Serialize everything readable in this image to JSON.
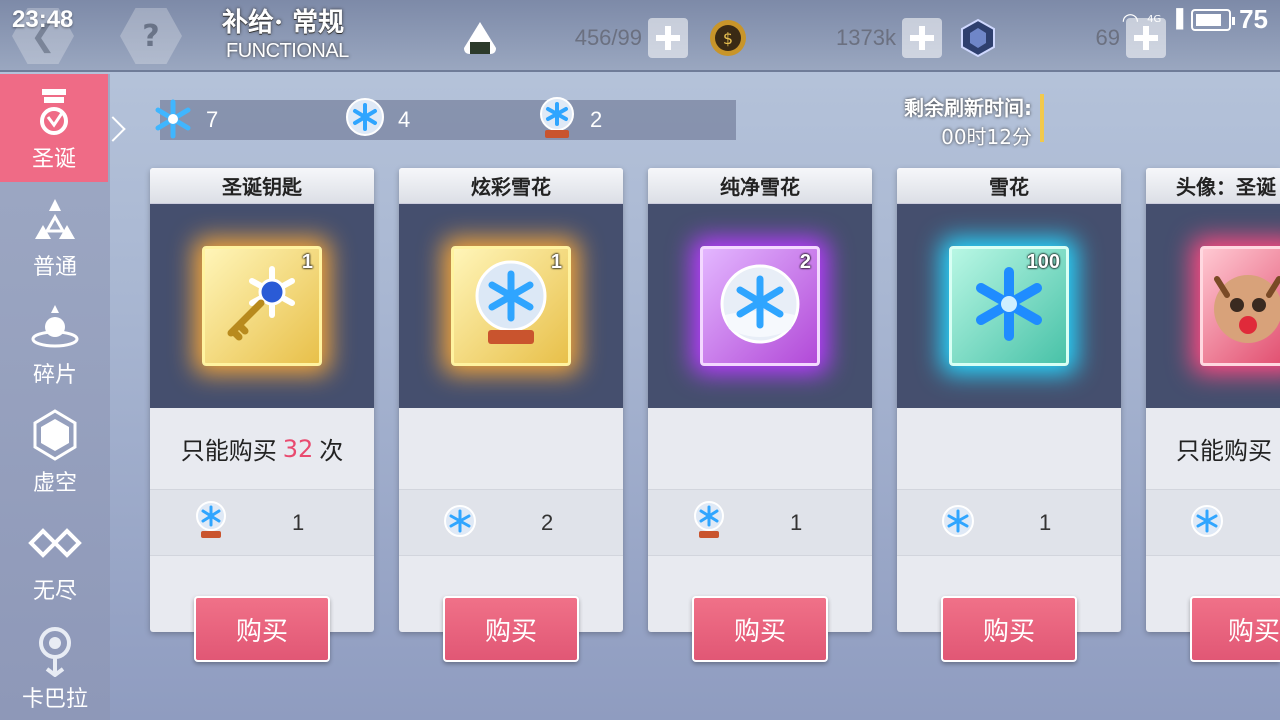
{
  "status": {
    "time": "23:48",
    "battery": "75",
    "network": "4G"
  },
  "header": {
    "title": "补给· 常规",
    "subtitle": "FUNCTIONAL",
    "help": "?",
    "resources": [
      {
        "name": "stamina",
        "icon": "rice-ball-icon",
        "value": "456/99"
      },
      {
        "name": "coin",
        "icon": "coin-icon",
        "value": "1373k"
      },
      {
        "name": "crystal",
        "icon": "crystal-icon",
        "value": "69"
      }
    ]
  },
  "sidebar": {
    "items": [
      {
        "label": "圣诞",
        "icon": "christmas-icon",
        "active": true
      },
      {
        "label": "普通",
        "icon": "triangle-icon",
        "active": false
      },
      {
        "label": "碎片",
        "icon": "fragment-icon",
        "active": false
      },
      {
        "label": "虚空",
        "icon": "hexagon-icon",
        "active": false
      },
      {
        "label": "无尽",
        "icon": "infinity-icon",
        "active": false
      },
      {
        "label": "卡巴拉",
        "icon": "kabbalah-icon",
        "active": false
      }
    ]
  },
  "currencies": [
    {
      "icon": "snowflake-icon",
      "value": "7"
    },
    {
      "icon": "snow-globe-icon",
      "value": "4"
    },
    {
      "icon": "snow-globe-red-icon",
      "value": "2"
    }
  ],
  "refresh": {
    "label": "剩余刷新时间:",
    "value": "00时12分"
  },
  "cards": [
    {
      "title": "圣诞钥匙",
      "qty": "1",
      "frame": "gold",
      "item_icon": "key-icon",
      "limit_prefix": "只能购买",
      "limit_count": "32",
      "limit_suffix": "次",
      "price_icon": "snow-globe-red-icon",
      "price": "1",
      "buy": "购买"
    },
    {
      "title": "炫彩雪花",
      "qty": "1",
      "frame": "gold",
      "item_icon": "snow-globe-icon",
      "limit_prefix": "",
      "limit_count": "",
      "limit_suffix": "",
      "price_icon": "snowflake-orb-icon",
      "price": "2",
      "buy": "购买"
    },
    {
      "title": "纯净雪花",
      "qty": "2",
      "frame": "purple",
      "item_icon": "snowflake-orb-icon",
      "limit_prefix": "",
      "limit_count": "",
      "limit_suffix": "",
      "price_icon": "snow-globe-red-icon",
      "price": "1",
      "buy": "购买"
    },
    {
      "title": "雪花",
      "qty": "100",
      "frame": "cyan",
      "item_icon": "snowflake-icon",
      "limit_prefix": "",
      "limit_count": "",
      "limit_suffix": "",
      "price_icon": "snowflake-orb-icon",
      "price": "1",
      "buy": "购买"
    },
    {
      "title": "头像：圣诞",
      "qty": "",
      "frame": "red",
      "item_icon": "reindeer-avatar-icon",
      "limit_prefix": "只能购买",
      "limit_count": "",
      "limit_suffix": "",
      "price_icon": "snowflake-orb-icon",
      "price": "",
      "buy": "购买"
    }
  ]
}
